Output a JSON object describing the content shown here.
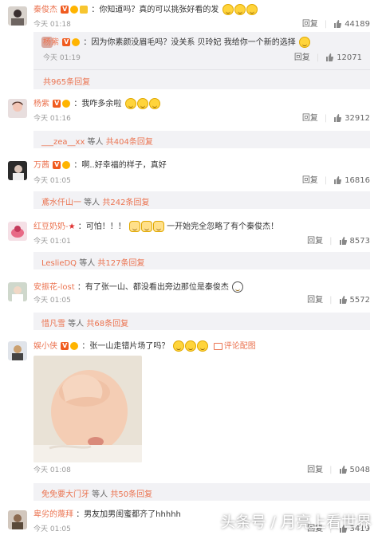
{
  "comments": [
    {
      "username": "秦俊杰",
      "text": "：你知道吗？真的可以挑张好看的发",
      "time": "今天 01:18",
      "reply_label": "回复",
      "likes": "44189"
    },
    {
      "username": "杨紫",
      "text": "：我咋多余啦",
      "time": "今天 01:16",
      "reply_label": "回复",
      "likes": "32912",
      "replies_user": "___zea__xx",
      "replies_mid": " 等人 ",
      "replies_count": "共404条回复"
    },
    {
      "username": "万茜",
      "text": "：啊..好幸福的样子，真好",
      "time": "今天 01:05",
      "reply_label": "回复",
      "likes": "16816",
      "replies_user": "鳶水仟山一",
      "replies_mid": " 等人 ",
      "replies_count": "共242条回复"
    },
    {
      "username": "红豆奶奶-",
      "text_a": "：可怕！！！",
      "text_b": "一开始完全忽略了有个秦俊杰！",
      "time": "今天 01:01",
      "reply_label": "回复",
      "likes": "8573",
      "replies_user": "LeslieDQ",
      "replies_mid": " 等人 ",
      "replies_count": "共127条回复"
    },
    {
      "username": "安振花-lost",
      "text": "：有了张一山、都没看出旁边那位是秦俊杰",
      "time": "今天 01:05",
      "reply_label": "回复",
      "likes": "5572",
      "replies_user": "惜凡雪",
      "replies_mid": " 等人 ",
      "replies_count": "共68条回复"
    },
    {
      "username": "娱小侠",
      "text": "：张一山走错片场了吗？",
      "pic_label": "评论配图",
      "time": "今天 01:08",
      "reply_label": "回复",
      "likes": "5048",
      "replies_user": "免免要大门牙",
      "replies_mid": " 等人 ",
      "replies_count": "共50条回复"
    },
    {
      "username": "卑劣的蔑拜",
      "text": "：男友加男闺蜜都齐了hhhhh",
      "time": "今天 01:05",
      "reply_label": "回复",
      "likes": "3419"
    }
  ],
  "nested_reply": {
    "username": "杨紫",
    "text": "：因为你素颜没眉毛吗？没关系 贝玲妃 我给你一个新的选择",
    "time": "今天 01:19",
    "reply_label": "回复",
    "likes": "12071",
    "more": "共965条回复"
  },
  "watermark": "头条号 / 月亮上看世界",
  "colors": {
    "accent": "#eb7350",
    "reply_bg": "#f2f2f5",
    "meta": "#999999"
  },
  "icons": [
    "thumb-up-icon",
    "vip-badge-icon",
    "smile-emoji-icon",
    "cat-emoji-icon",
    "picture-icon"
  ]
}
